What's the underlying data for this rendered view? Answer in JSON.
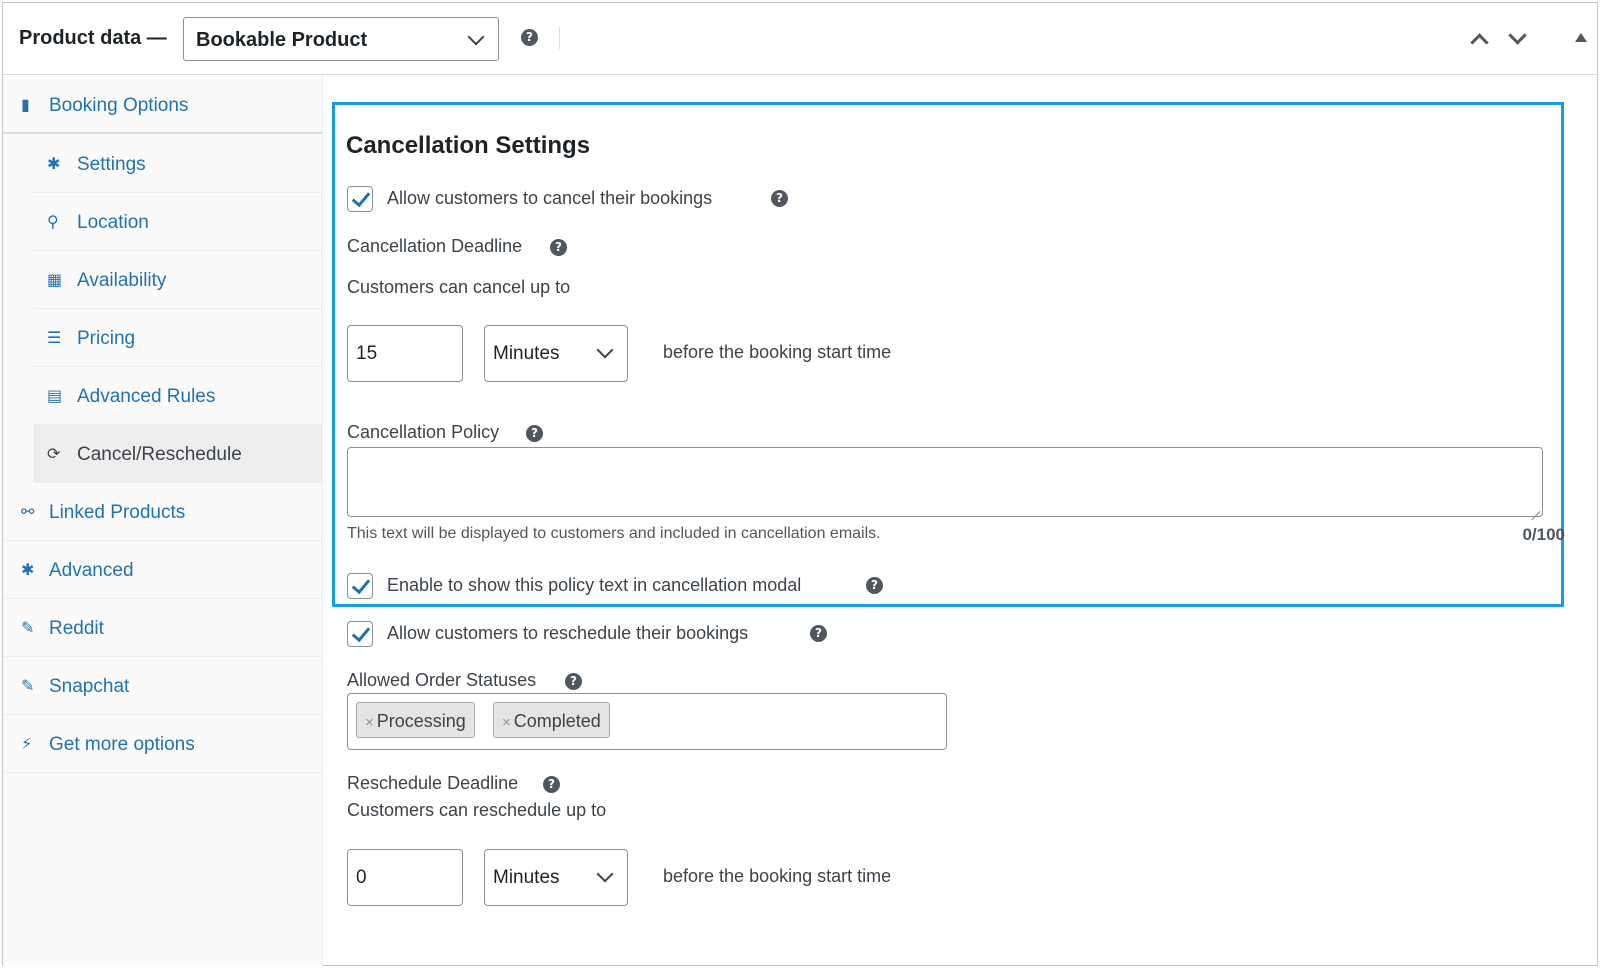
{
  "header": {
    "title": "Product data —",
    "product_type": "Bookable Product"
  },
  "sidebar": {
    "items": [
      {
        "label": "Booking Options",
        "icon": "book-icon"
      },
      {
        "label": "Settings",
        "icon": "gear-icon"
      },
      {
        "label": "Location",
        "icon": "location-pin-icon"
      },
      {
        "label": "Availability",
        "icon": "calendar-icon"
      },
      {
        "label": "Pricing",
        "icon": "list-icon"
      },
      {
        "label": "Advanced Rules",
        "icon": "grid-icon"
      },
      {
        "label": "Cancel/Reschedule",
        "icon": "refresh-icon",
        "active": true
      },
      {
        "label": "Linked Products",
        "icon": "link-icon"
      },
      {
        "label": "Advanced",
        "icon": "gear-icon"
      },
      {
        "label": "Reddit",
        "icon": "wrench-icon"
      },
      {
        "label": "Snapchat",
        "icon": "wrench-icon"
      },
      {
        "label": "Get more options",
        "icon": "plugin-icon"
      }
    ]
  },
  "cancellation": {
    "title": "Cancellation Settings",
    "allow_cancel_label": "Allow customers to cancel their bookings",
    "allow_cancel_checked": true,
    "deadline_label": "Cancellation Deadline",
    "deadline_sub": "Customers can cancel up to",
    "deadline_value": "15",
    "deadline_unit": "Minutes",
    "deadline_suffix": "before the booking start time",
    "policy_label": "Cancellation Policy",
    "policy_value": "",
    "policy_hint": "This text will be displayed to customers and included in cancellation emails.",
    "policy_counter": "0/100",
    "show_policy_label": "Enable to show this policy text in cancellation modal",
    "show_policy_checked": true
  },
  "reschedule": {
    "allow_label": "Allow customers to reschedule their bookings",
    "allow_checked": true,
    "statuses_label": "Allowed Order Statuses",
    "statuses": [
      "Processing",
      "Completed"
    ],
    "deadline_label": "Reschedule Deadline",
    "deadline_sub": "Customers can reschedule up to",
    "deadline_value": "0",
    "deadline_unit": "Minutes",
    "deadline_suffix": "before the booking start time"
  },
  "colors": {
    "link": "#2271b1",
    "highlight_border": "#1a9be8"
  }
}
